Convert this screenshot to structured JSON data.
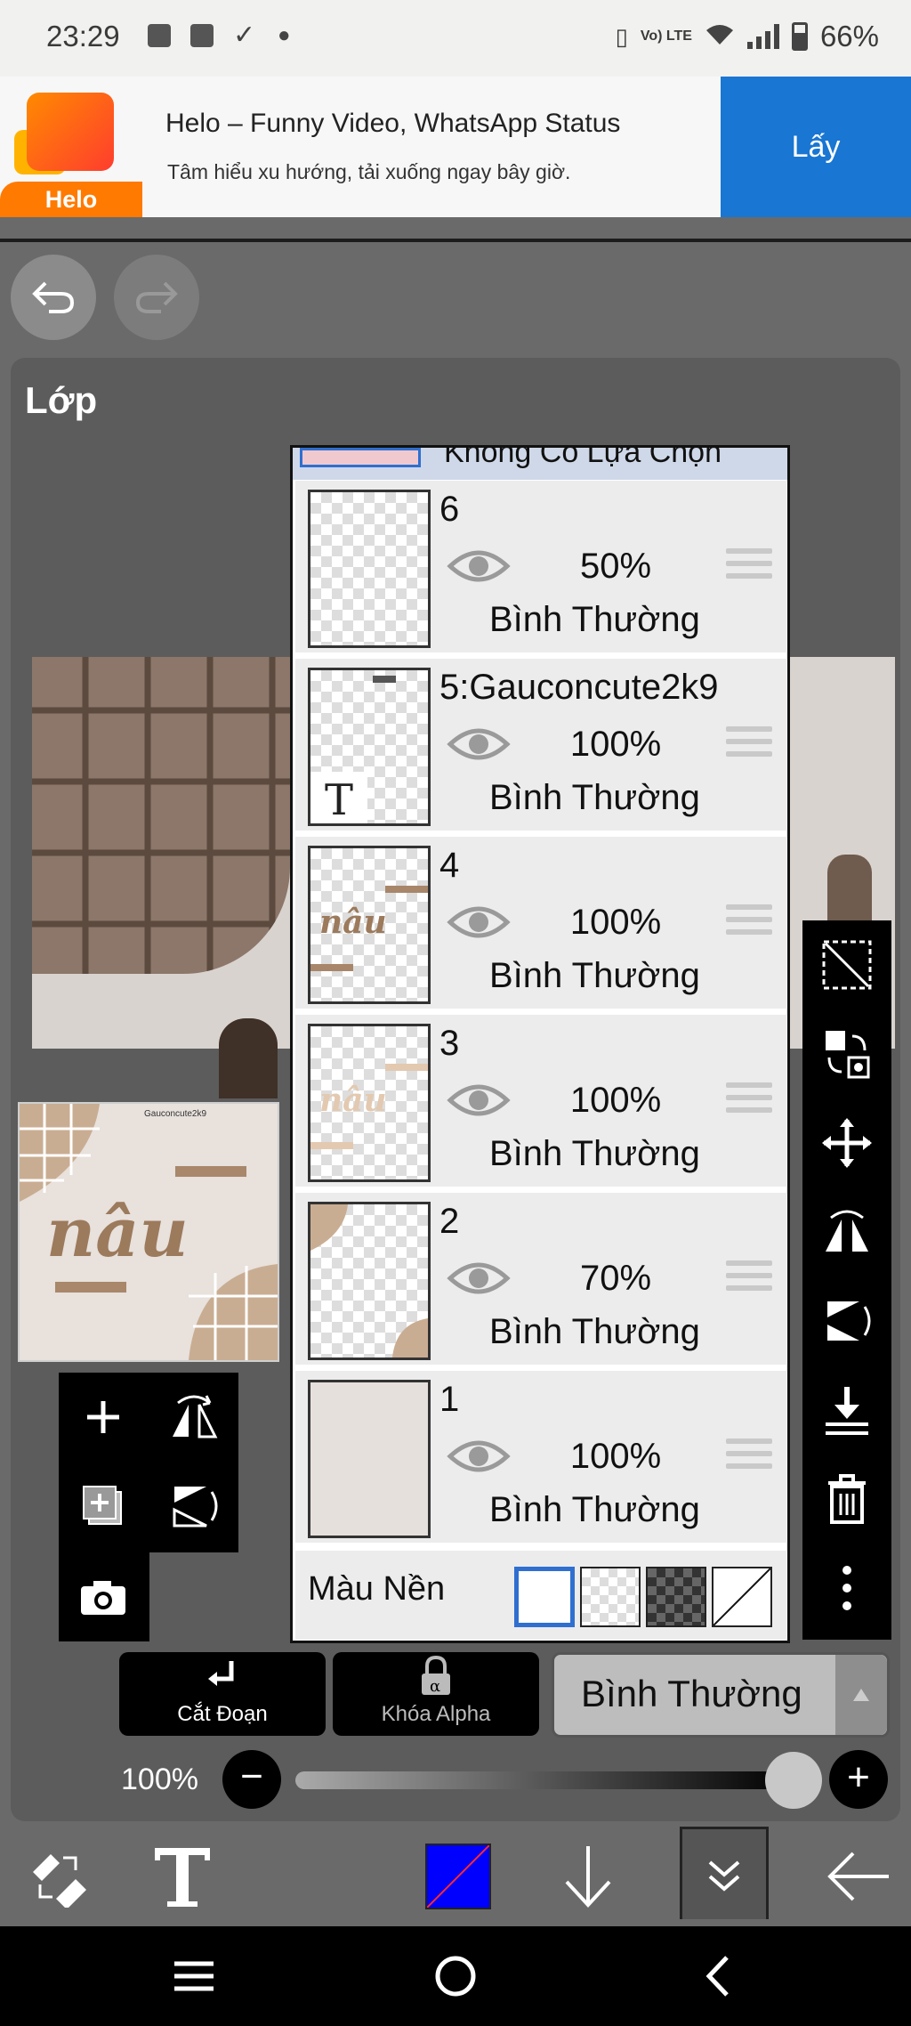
{
  "status_bar": {
    "time": "23:29",
    "network": "Vo) LTE",
    "battery": "66%"
  },
  "ad": {
    "brand": "Helo",
    "title": "Helo – Funny Video, WhatsApp Status",
    "subtitle": "Tâm hiểu xu hướng, tải xuống ngay bây giờ.",
    "cta": "Lấy"
  },
  "panel": {
    "title": "Lớp",
    "selection_row": "Không Có Lựa Chọn"
  },
  "thumbnail": {
    "text": "nâu",
    "small_text": "Gauconcute2k9"
  },
  "layers": [
    {
      "name": "6",
      "opacity": "50%",
      "blend": "Bình Thường",
      "visible": true
    },
    {
      "name": "5:Gauconcute2k9",
      "opacity": "100%",
      "blend": "Bình Thường",
      "visible": true,
      "type_glyph": "T"
    },
    {
      "name": "4",
      "opacity": "100%",
      "blend": "Bình Thường",
      "visible": true,
      "thumb_text": "nâu"
    },
    {
      "name": "3",
      "opacity": "100%",
      "blend": "Bình Thường",
      "visible": true,
      "thumb_text": "nâu"
    },
    {
      "name": "2",
      "opacity": "70%",
      "blend": "Bình Thường",
      "visible": true
    },
    {
      "name": "1",
      "opacity": "100%",
      "blend": "Bình Thường",
      "visible": true
    }
  ],
  "background_row": {
    "label": "Màu Nền"
  },
  "actions": {
    "clipping": "Cắt Đoạn",
    "alpha_lock": "Khóa Alpha",
    "blend_mode": "Bình Thường"
  },
  "opacity": {
    "value": "100%",
    "fraction": 1.0
  },
  "colors": {
    "current_color": "#0000ff",
    "cta_blue": "#1976d2",
    "panel_bg": "#5c5c5c"
  },
  "icons": {
    "undo": "undo-icon",
    "redo": "redo-icon",
    "add_layer": "plus-icon",
    "camera": "camera-icon",
    "text_tool": "text-icon",
    "eraser": "eraser-icon",
    "trash": "trash-icon"
  }
}
